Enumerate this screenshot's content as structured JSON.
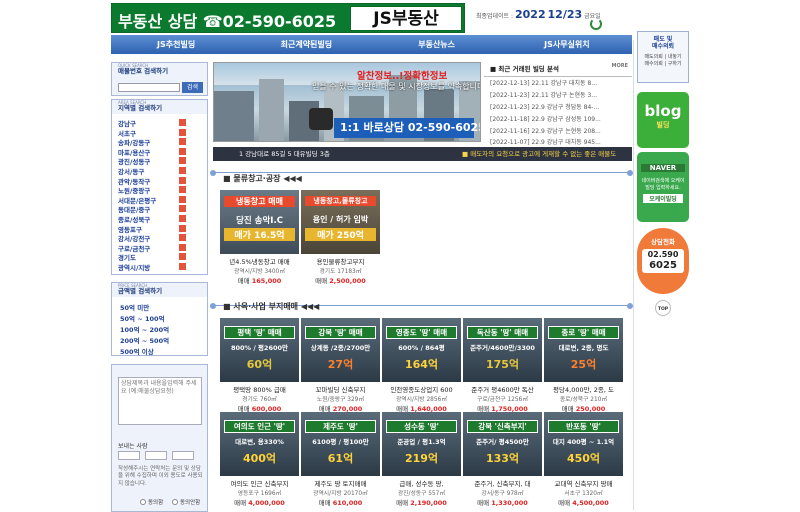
{
  "header": {
    "logo_text": "부동산 상담 ☎02-590-6025",
    "logo_box": "JS부동산",
    "update_label": "최종업데이트 :",
    "update_year": "2022",
    "update_date": "12/23",
    "update_day": "금요일"
  },
  "nav": [
    "JS추천빌딩",
    "최근계약된빌딩",
    "부동산뉴스",
    "JS사무실위치"
  ],
  "sidebar": {
    "search": {
      "sub": "QUICK SEARCH",
      "title": "매물번호 검색하기",
      "button": "검색"
    },
    "area": {
      "sub": "AREA SEARCH",
      "title": "지역별 검색하기",
      "items": [
        "강남구",
        "서초구",
        "송파/강동구",
        "마포/용산구",
        "광진/성동구",
        "강서/동구",
        "관악/동작구",
        "노원/중랑구",
        "서대문/은평구",
        "동대문/중구",
        "종로/성북구",
        "영등포구",
        "강서/강전구",
        "구로/금천구",
        "경기도",
        "광역시/지방"
      ]
    },
    "price": {
      "sub": "PRICE SEARCH",
      "title": "금액별 검색하기",
      "items": [
        "50억 미만",
        "50억 ~ 100억",
        "100억 ~ 200억",
        "200억 ~ 500억",
        "500억 이상"
      ]
    },
    "inquiry": {
      "placeholder": "상담제목과 내용을입력해 주세요 (예:매물상담요청)",
      "sender_label": "보내는 사람",
      "notice": "작성해주시는 연락처는 문의 및 상담을 위해 수집하며 이외 용도로 사용되지 않습니다.",
      "agree": "동의함",
      "disagree": "동의안함"
    }
  },
  "banner": {
    "line1": "알찬정보..!정확한정보",
    "line2": "믿을 수 있는 정확한 매물 및 시장정보를 약속합니다",
    "call": "1:1 바로상담 02-590-6025"
  },
  "news": {
    "title": "최근 거래된 빌딩 분석",
    "more": "MORE",
    "items": [
      "[2022-12-13] 22.11 강남구 대치동 8...",
      "[2022-11-23] 22.11 강남구 논현동 3...",
      "[2022-11-23] 22.9 강남구 청담동 84-...",
      "[2022-11-18] 22.9 강남구 삼성동 109...",
      "[2022-11-16] 22.9 강남구 논현동 208...",
      "[2022-11-07] 22.9 강남구 대치동 945..."
    ]
  },
  "ticker": {
    "left": "1 강남대로 85길 5 대유빌딩 3층",
    "right": "■ 매도자의 요청으로 광고에 게재할 수 없는 좋은 매물도 "
  },
  "section1": {
    "title": "물류창고·공장",
    "cards": [
      {
        "img1": "냉동창고 매매",
        "img2": "당진 송악I.C",
        "img3": "매가 16.5억",
        "name": "년4.5%냉동창고 매매",
        "addr": "광역시/지방 3400㎡",
        "price_label": "매매",
        "price": "165,000"
      },
      {
        "img1": "냉동창고,물류창고",
        "img2": "용인 / 허가 임박",
        "img3": "매가 250억",
        "name": "용인물류창고부지",
        "addr": "경기도 17183㎡",
        "price_label": "매매",
        "price": "2,500,000"
      }
    ]
  },
  "section2": {
    "title": "사옥·사업 부지매매",
    "cards": [
      {
        "tag": "평택 '땅' 매매",
        "sub": "800% / 평2600만",
        "big": "60억",
        "name": "평택땅 800% 급매",
        "addr": "경기도 760㎡",
        "price_label": "매매",
        "price": "600,000"
      },
      {
        "tag": "강북 '땅' 매매",
        "sub": "상계동 /2종/2700만",
        "big": "27억",
        "name": "꼬마빌딩 신축부지",
        "addr": "노원/중랑구 329㎡",
        "price_label": "매매",
        "price": "270,000"
      },
      {
        "tag": "영종도 '땅' 매매",
        "sub": "600% / 864평",
        "big": "164억",
        "name": "인천영종도상업지 600",
        "addr": "광역시/지방 2856㎡",
        "price_label": "매매",
        "price": "1,640,000"
      },
      {
        "tag": "독산동 '땅' 매매",
        "sub": "준주거/4600만/3300",
        "big": "175억",
        "name": "준주거 평4600만 독산",
        "addr": "구로/금천구 1256㎡",
        "price_label": "매매",
        "price": "1,750,000"
      },
      {
        "tag": "종로 '땅' 매매",
        "sub": "대로변, 2종, 명도",
        "big": "25억",
        "name": "평당4,000만, 2종, 도",
        "addr": "종로/성북구 210㎡",
        "price_label": "매매",
        "price": "250,000"
      },
      {
        "tag": "여의도 인근 '땅'",
        "sub": "대로변, 용330%",
        "big": "400억",
        "name": "여의도 인근 신축부지",
        "addr": "영등포구 1696㎡",
        "price_label": "매매",
        "price": "4,000,000"
      },
      {
        "tag": "제주도 '땅'",
        "sub": "6100평 / 평100만",
        "big": "61억",
        "name": "제주도 땅 토지매매",
        "addr": "광역시/지방 20170㎡",
        "price_label": "매매",
        "price": "610,000"
      },
      {
        "tag": "성수동 '땅'",
        "sub": "준공업 / 평1.3억",
        "big": "219억",
        "name": "급매, 성수동 땅,",
        "addr": "광진/성동구 557㎡",
        "price_label": "매매",
        "price": "2,190,000"
      },
      {
        "tag": "강북 '신축부지'",
        "sub": "준주거/ 평4500만",
        "big": "133억",
        "name": "준주거, 신축부지, 대",
        "addr": "강서/동구 978㎡",
        "price_label": "매매",
        "price": "1,330,000"
      },
      {
        "tag": "반포동 '땅'",
        "sub": "대지 400평 ~ 1.1억",
        "big": "450억",
        "name": "교대역 신축부지 땅매",
        "addr": "서초구 1320㎡",
        "price_label": "매매",
        "price": "4,500,000"
      }
    ]
  },
  "right": {
    "btn1_l1": "매도 및",
    "btn1_l2": "매수의뢰",
    "btn1_l3": "매도의뢰 | 내놓기",
    "btn1_l4": "매수의뢰 | 구하기",
    "blog": "blog",
    "blog_sub": "빌딩",
    "naver": "NAVER",
    "naver_sub": "네이버검색에 오케이빌딩 입력하세요.",
    "naver_btn": "오케이빌딩",
    "call_title": "상담전화",
    "call_num1": "02.590",
    "call_num2": "6025",
    "top": "TOP"
  }
}
